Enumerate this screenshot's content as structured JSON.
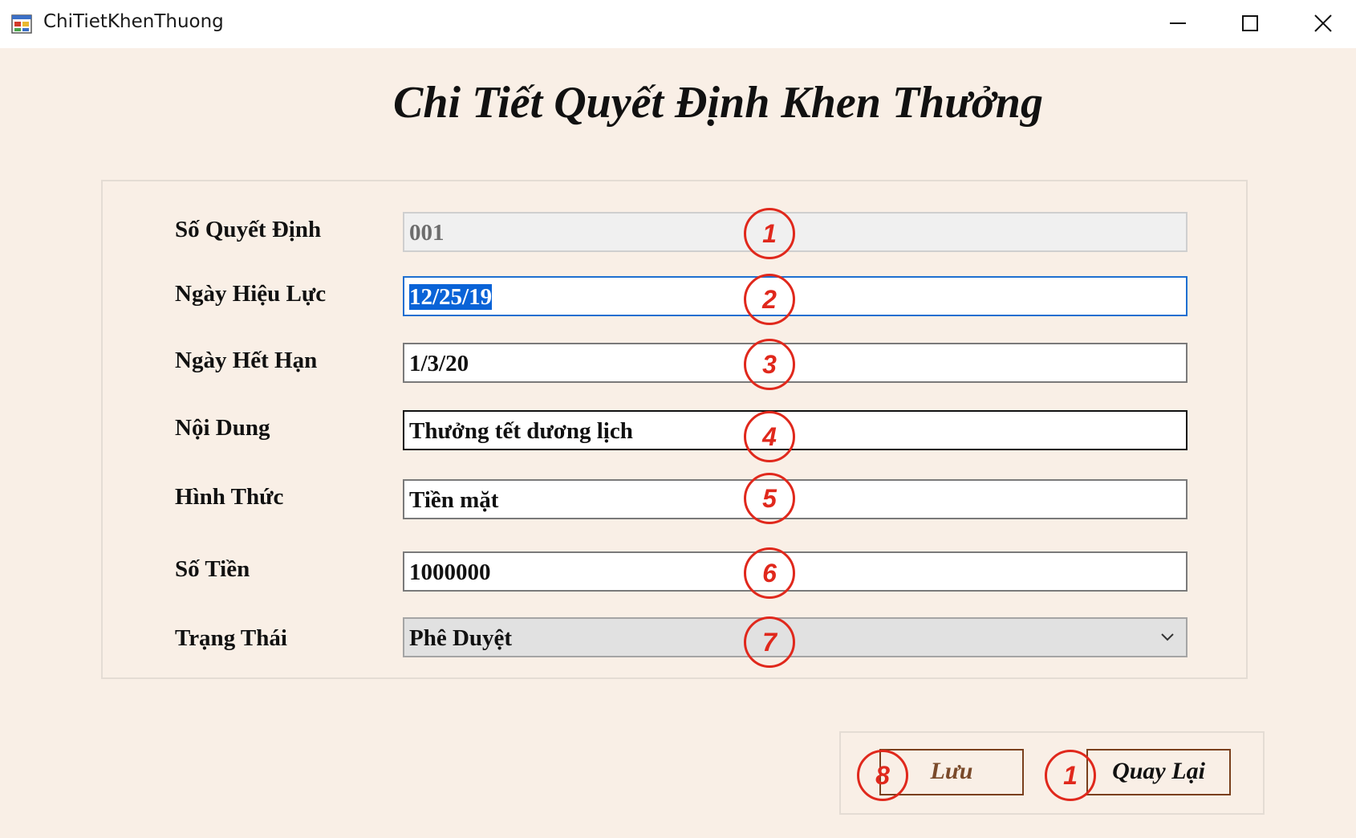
{
  "window": {
    "title": "ChiTietKhenThuong"
  },
  "form": {
    "title": "Chi Tiết Quyết Định Khen Thưởng",
    "fields": [
      {
        "label": "Số Quyết Định",
        "value": "001",
        "badge": "1"
      },
      {
        "label": "Ngày Hiệu Lực",
        "value": "12/25/19",
        "badge": "2"
      },
      {
        "label": "Ngày Hết Hạn",
        "value": "1/3/20",
        "badge": "3"
      },
      {
        "label": "Nội Dung",
        "value": "Thưởng tết dương lịch",
        "badge": "4"
      },
      {
        "label": "Hình Thức",
        "value": "Tiền mặt",
        "badge": "5"
      },
      {
        "label": "Số Tiền",
        "value": "1000000",
        "badge": "6"
      },
      {
        "label": "Trạng Thái",
        "value": "Phê Duyệt",
        "badge": "7"
      }
    ]
  },
  "buttons": {
    "save": {
      "label": "Lưu",
      "badge": "8"
    },
    "back": {
      "label": "Quay Lại",
      "badge": "1"
    }
  },
  "colors": {
    "background": "#f9efe6",
    "annotation": "#e0281c",
    "selection": "#0a63d7",
    "focus_border": "#1e6fd0"
  }
}
